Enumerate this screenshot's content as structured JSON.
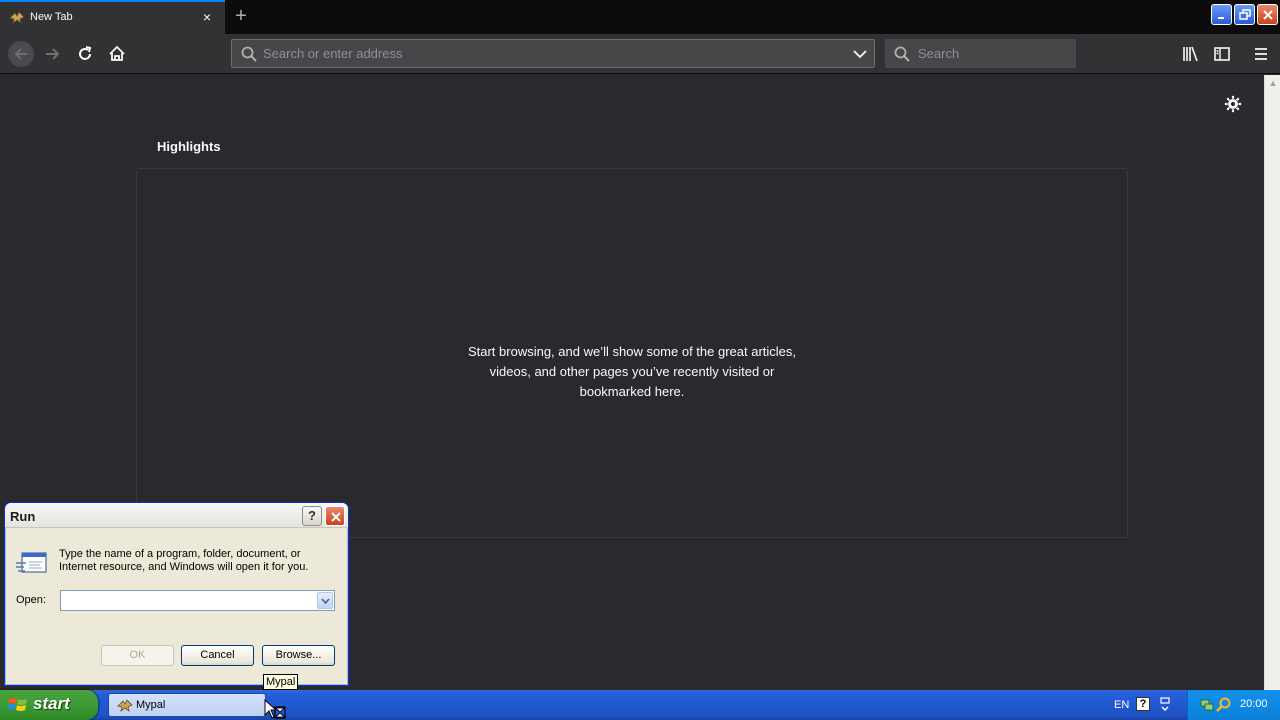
{
  "browser": {
    "tab": {
      "title": "New Tab",
      "close_glyph": "×"
    },
    "new_tab_glyph": "+",
    "urlbar": {
      "placeholder": "Search or enter address"
    },
    "searchbar": {
      "placeholder": "Search"
    }
  },
  "content": {
    "highlights_title": "Highlights",
    "empty_message": [
      "Start browsing, and we’ll show some of the great articles,",
      "videos, and other pages you’ve recently visited or",
      "bookmarked here."
    ]
  },
  "run_dialog": {
    "title": "Run",
    "help_glyph": "?",
    "description": [
      "Type the name of a program, folder, document, or",
      "Internet resource, and Windows will open it for you."
    ],
    "open_label": "Open:",
    "open_value": "",
    "ok_label": "OK",
    "cancel_label": "Cancel",
    "browse_label": "Browse..."
  },
  "tooltip": "Mypal",
  "taskbar": {
    "start_label": "start",
    "task_label": "Mypal",
    "language": "EN",
    "help_glyph": "?",
    "clock": "20:00"
  },
  "icons": {
    "back": "back-arrow-icon",
    "forward": "forward-arrow-icon",
    "reload": "reload-icon",
    "home": "home-icon",
    "library": "library-icon",
    "sidebar": "sidebar-icon",
    "menu": "hamburger-menu-icon",
    "settings": "gear-icon"
  },
  "colors": {
    "content_bg": "#2a2a2e",
    "toolbar_bg": "#323234",
    "tab_strip_bg": "#0c0c0d",
    "accent": "#0a84ff",
    "xp_taskbar": "#245edb",
    "xp_start": "#3d9a34"
  }
}
